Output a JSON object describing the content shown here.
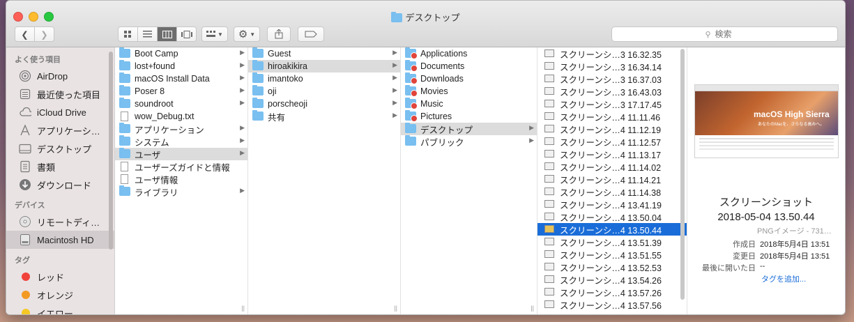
{
  "window": {
    "title": "デスクトップ"
  },
  "toolbar": {
    "search_placeholder": "検索"
  },
  "sidebar": {
    "favorites_header": "よく使う項目",
    "favorites": [
      {
        "label": "AirDrop",
        "icon": "airdrop-icon"
      },
      {
        "label": "最近使った項目",
        "icon": "recents-icon"
      },
      {
        "label": "iCloud Drive",
        "icon": "cloud-icon"
      },
      {
        "label": "アプリケーシ…",
        "icon": "applications-icon"
      },
      {
        "label": "デスクトップ",
        "icon": "desktop-icon"
      },
      {
        "label": "書類",
        "icon": "documents-icon"
      },
      {
        "label": "ダウンロード",
        "icon": "downloads-icon"
      }
    ],
    "devices_header": "デバイス",
    "devices": [
      {
        "label": "リモートディ…",
        "icon": "remote-disc-icon"
      },
      {
        "label": "Macintosh HD",
        "icon": "hard-drive-icon"
      }
    ],
    "tags_header": "タグ",
    "tags": [
      {
        "label": "レッド",
        "color": "#f0433b"
      },
      {
        "label": "オレンジ",
        "color": "#f39a23"
      },
      {
        "label": "イエロー",
        "color": "#f5c825"
      }
    ]
  },
  "columns": {
    "col1": [
      {
        "label": "Boot Camp",
        "type": "folder",
        "arrow": true
      },
      {
        "label": "lost+found",
        "type": "folder",
        "arrow": true
      },
      {
        "label": "macOS Install Data",
        "type": "folder",
        "arrow": true
      },
      {
        "label": "Poser 8",
        "type": "folder",
        "arrow": true
      },
      {
        "label": "soundroot",
        "type": "folder",
        "arrow": true
      },
      {
        "label": "wow_Debug.txt",
        "type": "doc",
        "arrow": false
      },
      {
        "label": "アプリケーション",
        "type": "folder",
        "arrow": true
      },
      {
        "label": "システム",
        "type": "folder",
        "arrow": true
      },
      {
        "label": "ユーザ",
        "type": "folder",
        "arrow": true,
        "selected": true
      },
      {
        "label": "ユーザーズガイドと情報",
        "type": "doc",
        "arrow": false
      },
      {
        "label": "ユーザ情報",
        "type": "doc",
        "arrow": false
      },
      {
        "label": "ライブラリ",
        "type": "folder",
        "arrow": true
      }
    ],
    "col2": [
      {
        "label": "Guest",
        "type": "folder",
        "arrow": true
      },
      {
        "label": "hiroakikira",
        "type": "folder",
        "arrow": true,
        "selected": true
      },
      {
        "label": "imantoko",
        "type": "folder",
        "arrow": true
      },
      {
        "label": "oji",
        "type": "folder",
        "arrow": true
      },
      {
        "label": "porscheoji",
        "type": "folder",
        "arrow": true
      },
      {
        "label": "共有",
        "type": "folder",
        "arrow": true
      }
    ],
    "col3": [
      {
        "label": "Applications",
        "type": "folder-badge",
        "arrow": false
      },
      {
        "label": "Documents",
        "type": "folder-badge",
        "arrow": false
      },
      {
        "label": "Downloads",
        "type": "folder-badge",
        "arrow": false
      },
      {
        "label": "Movies",
        "type": "folder-badge",
        "arrow": false
      },
      {
        "label": "Music",
        "type": "folder-badge",
        "arrow": false
      },
      {
        "label": "Pictures",
        "type": "folder-badge",
        "arrow": false
      },
      {
        "label": "デスクトップ",
        "type": "folder",
        "arrow": true,
        "selected": true
      },
      {
        "label": "パブリック",
        "type": "folder",
        "arrow": true
      }
    ],
    "col4": [
      {
        "label": "スクリーンシ…3 16.32.35"
      },
      {
        "label": "スクリーンシ…3 16.34.14"
      },
      {
        "label": "スクリーンシ…3 16.37.03"
      },
      {
        "label": "スクリーンシ…3 16.43.03"
      },
      {
        "label": "スクリーンシ…3 17.17.45"
      },
      {
        "label": "スクリーンシ…4 11.11.46"
      },
      {
        "label": "スクリーンシ…4 11.12.19"
      },
      {
        "label": "スクリーンシ…4 11.12.57"
      },
      {
        "label": "スクリーンシ…4 11.13.17"
      },
      {
        "label": "スクリーンシ…4 11.14.02"
      },
      {
        "label": "スクリーンシ…4 11.14.21"
      },
      {
        "label": "スクリーンシ…4 11.14.38"
      },
      {
        "label": "スクリーンシ…4 13.41.19"
      },
      {
        "label": "スクリーンシ…4 13.50.04"
      },
      {
        "label": "スクリーンシ…4 13.50.44",
        "selected": true
      },
      {
        "label": "スクリーンシ…4 13.51.39"
      },
      {
        "label": "スクリーンシ…4 13.51.55"
      },
      {
        "label": "スクリーンシ…4 13.52.53"
      },
      {
        "label": "スクリーンシ…4 13.54.26"
      },
      {
        "label": "スクリーンシ…4 13.57.26"
      },
      {
        "label": "スクリーンシ…4 13.57.56"
      }
    ]
  },
  "preview": {
    "thumb_title": "macOS High Sierra",
    "thumb_subtitle": "あなたのMacを、さらなる高みへ。",
    "name_line1": "スクリーンショット",
    "name_line2": "2018-05-04 13.50.44",
    "kind": "PNGイメージ - 731…",
    "created_label": "作成日",
    "created_value": "2018年5月4日 13:51",
    "modified_label": "変更日",
    "modified_value": "2018年5月4日 13:51",
    "opened_label": "最後に開いた日",
    "opened_value": "--",
    "add_tags": "タグを追加..."
  },
  "colors": {
    "selection_blue": "#1a6dd8",
    "folder_blue": "#79bff0"
  }
}
